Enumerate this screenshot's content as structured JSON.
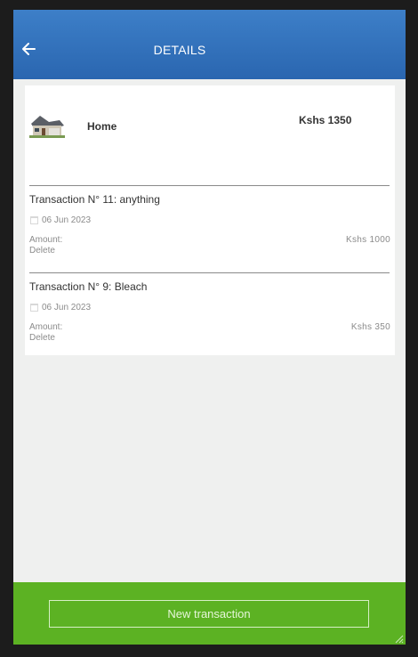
{
  "header": {
    "title": "DETAILS",
    "back_icon": "arrow-left-icon"
  },
  "category": {
    "name": "Home",
    "total": "Kshs 1350",
    "icon": "house-icon"
  },
  "transactions": [
    {
      "title": "Transaction N° 11: anything",
      "date": "06 Jun 2023",
      "amount_label": "Amount:",
      "amount": "Kshs 1000",
      "delete_label": "Delete"
    },
    {
      "title": "Transaction N° 9: Bleach",
      "date": "06 Jun 2023",
      "amount_label": "Amount:",
      "amount": "Kshs 350",
      "delete_label": "Delete"
    }
  ],
  "footer": {
    "new_transaction_label": "New transaction"
  },
  "colors": {
    "header": "#2a66b0",
    "footer": "#5cb223",
    "background": "#eff0ef"
  }
}
